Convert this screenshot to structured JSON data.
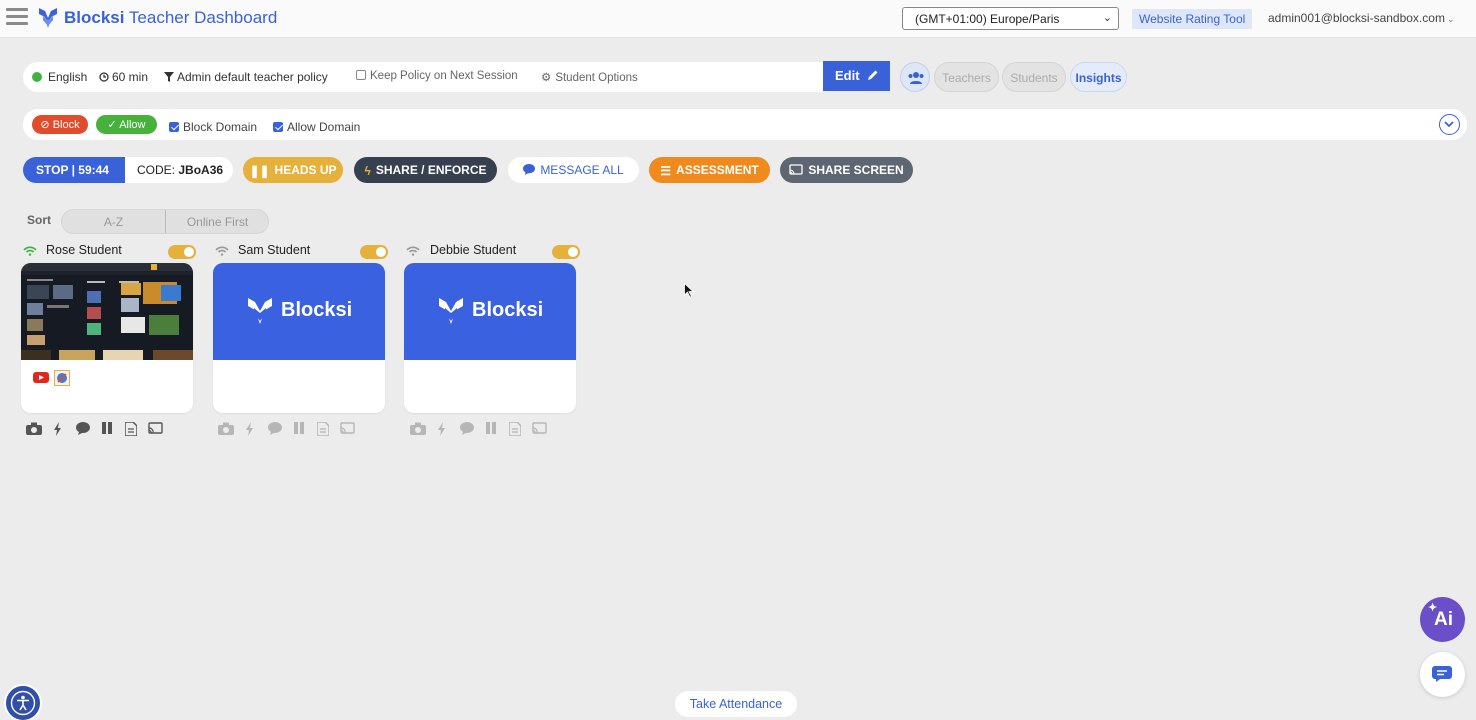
{
  "header": {
    "brand_name": "Blocksi",
    "brand_suffix": "Teacher Dashboard",
    "timezone": "(GMT+01:00) Europe/Paris",
    "rating_tool": "Website Rating Tool",
    "account": "admin001@blocksi-sandbox.com"
  },
  "policy": {
    "language": "English",
    "duration": "60 min",
    "policy_name": "Admin default teacher policy",
    "keep_policy": "Keep Policy on Next Session",
    "student_options": "Student Options",
    "edit_label": "Edit"
  },
  "tabs": {
    "teachers": "Teachers",
    "students": "Students",
    "insights": "Insights"
  },
  "domains": {
    "block_label": "Block",
    "allow_label": "Allow",
    "block_domain": "Block Domain",
    "allow_domain": "Allow Domain"
  },
  "session": {
    "stop_label": "STOP | 59:44",
    "code_prefix": "CODE:",
    "code_value": "JBoA36"
  },
  "actions": {
    "heads_up": "HEADS UP",
    "share_enforce": "SHARE / ENFORCE",
    "message_all": "MESSAGE ALL",
    "assessment": "ASSESSMENT",
    "share_screen": "SHARE SCREEN"
  },
  "sort": {
    "label": "Sort",
    "options": [
      "A-Z",
      "Online First"
    ]
  },
  "students": [
    {
      "name": "Rose Student",
      "screen": "screenshot"
    },
    {
      "name": "Sam Student",
      "screen": "blocksi"
    },
    {
      "name": "Debbie Student",
      "screen": "blocksi"
    }
  ],
  "card_logo_text": "Blocksi",
  "footer": {
    "attendance": "Take Attendance",
    "ai_label": "Ai"
  },
  "colors": {
    "accent": "#3a62d8",
    "block": "#e04c2c",
    "allow": "#46b23b",
    "heads_up": "#e6b13a",
    "share_enforce": "#36404f",
    "assessment": "#f08a1c",
    "share_screen": "#5e6672",
    "ai": "#6a4fc8"
  }
}
